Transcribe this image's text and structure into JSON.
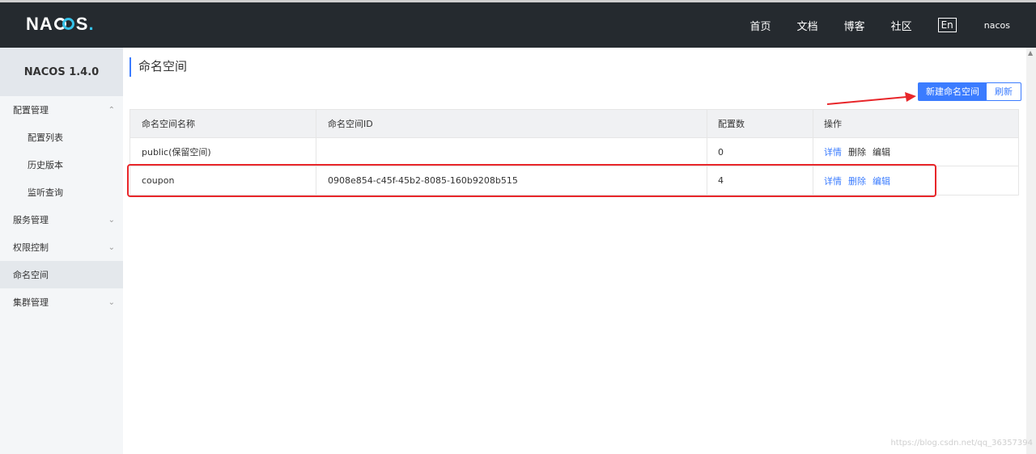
{
  "header": {
    "logo": "NACOS",
    "nav": [
      "首页",
      "文档",
      "博客",
      "社区"
    ],
    "lang": "En",
    "user": "nacos"
  },
  "sidebar": {
    "title": "NACOS 1.4.0",
    "items": [
      {
        "label": "配置管理",
        "type": "group",
        "chevron": "^"
      },
      {
        "label": "配置列表",
        "type": "sub"
      },
      {
        "label": "历史版本",
        "type": "sub"
      },
      {
        "label": "监听查询",
        "type": "sub"
      },
      {
        "label": "服务管理",
        "type": "group",
        "chevron": "v"
      },
      {
        "label": "权限控制",
        "type": "group",
        "chevron": "v"
      },
      {
        "label": "命名空间",
        "type": "item",
        "active": true
      },
      {
        "label": "集群管理",
        "type": "group",
        "chevron": "v"
      }
    ]
  },
  "main": {
    "title": "命名空间",
    "new_button": "新建命名空间",
    "refresh_button": "刷新",
    "table": {
      "columns": [
        "命名空间名称",
        "命名空间ID",
        "配置数",
        "操作"
      ],
      "rows": [
        {
          "name": "public(保留空间)",
          "id": "",
          "count": "0",
          "ops": [
            "详情",
            "删除",
            "编辑"
          ]
        },
        {
          "name": "coupon",
          "id": "0908e854-c45f-45b2-8085-160b9208b515",
          "count": "4",
          "ops": [
            "详情",
            "删除",
            "编辑"
          ]
        }
      ]
    }
  },
  "watermark": "https://blog.csdn.net/qq_36357394",
  "colors": {
    "accent": "#3b7cff",
    "annotation": "#e8262a",
    "topbar": "#252a2f"
  }
}
